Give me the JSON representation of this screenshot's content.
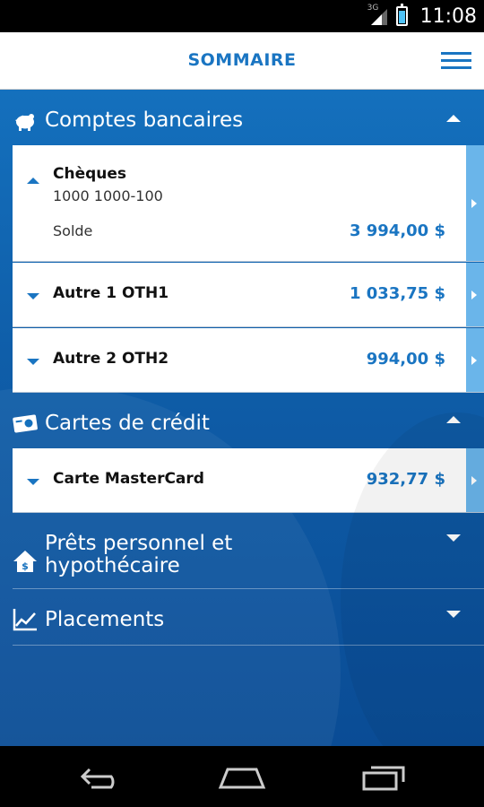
{
  "status_bar": {
    "network": "3G",
    "time": "11:08",
    "battery_level": 0.85
  },
  "header": {
    "title": "SOMMAIRE",
    "menu_icon": "hamburger-menu-icon"
  },
  "sections": {
    "comptes": {
      "title": "Comptes bancaires",
      "icon": "piggy-bank-icon",
      "expanded": true,
      "accounts": [
        {
          "name": "Chèques",
          "number": "1000 1000-100",
          "solde_label": "Solde",
          "amount": "3 994,00 $",
          "expanded": true
        },
        {
          "name": "Autre 1 OTH1",
          "amount": "1 033,75 $",
          "expanded": false
        },
        {
          "name": "Autre 2 OTH2",
          "amount": "994,00 $",
          "expanded": false
        }
      ]
    },
    "cartes": {
      "title": "Cartes de crédit",
      "icon": "credit-card-icon",
      "expanded": true,
      "accounts": [
        {
          "name": "Carte MasterCard",
          "amount": "932,77 $",
          "expanded": false
        }
      ]
    },
    "prets": {
      "title_line1": "Prêts personnel et",
      "title_line2": "hypothécaire",
      "icon": "house-dollar-icon",
      "expanded": false
    },
    "placements": {
      "title": "Placements",
      "icon": "line-chart-icon",
      "expanded": false
    }
  },
  "nav_bar": {
    "back": "back-icon",
    "home": "home-icon",
    "recents": "recent-apps-icon"
  },
  "colors": {
    "accent": "#1a75c2",
    "background_blue": "#0f5ea9",
    "row_arrow": "#6ab5ea"
  }
}
